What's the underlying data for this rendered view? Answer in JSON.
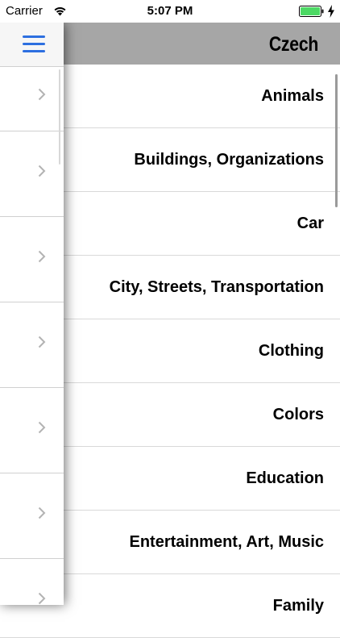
{
  "status_bar": {
    "carrier": "Carrier",
    "time": "5:07 PM",
    "icons": [
      "wifi-icon",
      "battery-icon",
      "charging-icon"
    ],
    "battery_color": "#4cd964"
  },
  "header": {
    "title": "Czech",
    "background": "#a6a6a6"
  },
  "categories": [
    "Animals",
    "Buildings, Organizations",
    "Car",
    "City, Streets, Transportation",
    "Clothing",
    "Colors",
    "Education",
    "Entertainment, Art, Music",
    "Family"
  ],
  "drawer": {
    "menu_icon": "hamburger-menu-icon",
    "accent_color": "#2d6fe0",
    "row_count": 7,
    "row_icon": "chevron-right-icon"
  }
}
